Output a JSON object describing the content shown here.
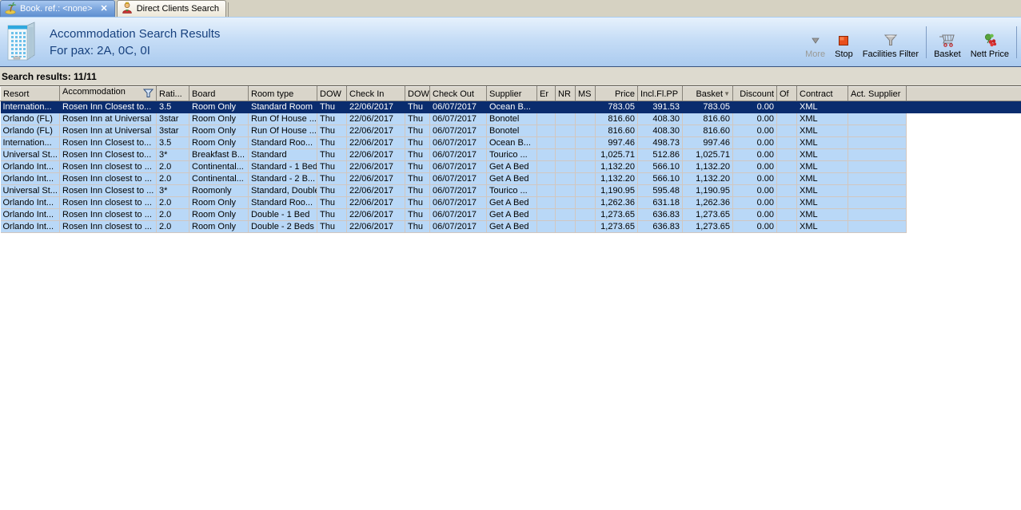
{
  "tabs": [
    {
      "label": "Book. ref.: <none>",
      "close_glyph": "✕",
      "icon": "palm-tree-icon",
      "active": true
    },
    {
      "label": "Direct Clients Search",
      "icon": "person-icon",
      "active": false
    }
  ],
  "header": {
    "title": "Accommodation Search Results",
    "subtitle": "For pax: 2A, 0C, 0I",
    "icon": "building-icon"
  },
  "toolbar": {
    "more": "More",
    "stop": "Stop",
    "facilities_filter": "Facilities Filter",
    "basket": "Basket",
    "nett_price": "Nett Price"
  },
  "results_bar": {
    "label": "Search results: 11/11"
  },
  "colors": {
    "selected_row": "#0A2C6E",
    "row_background": "#B9D8F7",
    "header_text": "#17417E",
    "stop_icon": "#E8501E"
  },
  "table": {
    "selected_index": 0,
    "columns": [
      {
        "label": "Resort"
      },
      {
        "label": "Accommodation",
        "filter_icon": "filter-funnel"
      },
      {
        "label": "Rati..."
      },
      {
        "label": "Board"
      },
      {
        "label": "Room type"
      },
      {
        "label": "DOW"
      },
      {
        "label": "Check In"
      },
      {
        "label": "DOW"
      },
      {
        "label": "Check Out"
      },
      {
        "label": "Supplier"
      },
      {
        "label": "Er"
      },
      {
        "label": "NR"
      },
      {
        "label": "MS"
      },
      {
        "label": "Price"
      },
      {
        "label": "Incl.Fl.PP"
      },
      {
        "label": "Basket",
        "sort_icon": "▼"
      },
      {
        "label": "Discount"
      },
      {
        "label": "Of"
      },
      {
        "label": "Contract"
      },
      {
        "label": "Act. Supplier"
      }
    ],
    "rows": [
      [
        "Internation...",
        "Rosen Inn Closest to...",
        "3.5",
        "Room Only",
        "Standard Room",
        "Thu",
        "22/06/2017",
        "Thu",
        "06/07/2017",
        "Ocean B...",
        "",
        "",
        "",
        "783.05",
        "391.53",
        "783.05",
        "0.00",
        "",
        "XML",
        ""
      ],
      [
        "Orlando (FL)",
        "Rosen Inn at Universal",
        "3star",
        "Room Only",
        "Run Of House ...",
        "Thu",
        "22/06/2017",
        "Thu",
        "06/07/2017",
        "Bonotel",
        "",
        "",
        "",
        "816.60",
        "408.30",
        "816.60",
        "0.00",
        "",
        "XML",
        ""
      ],
      [
        "Orlando (FL)",
        "Rosen Inn at Universal",
        "3star",
        "Room Only",
        "Run Of House ...",
        "Thu",
        "22/06/2017",
        "Thu",
        "06/07/2017",
        "Bonotel",
        "",
        "",
        "",
        "816.60",
        "408.30",
        "816.60",
        "0.00",
        "",
        "XML",
        ""
      ],
      [
        "Internation...",
        "Rosen Inn Closest to...",
        "3.5",
        "Room Only",
        "Standard Roo...",
        "Thu",
        "22/06/2017",
        "Thu",
        "06/07/2017",
        "Ocean B...",
        "",
        "",
        "",
        "997.46",
        "498.73",
        "997.46",
        "0.00",
        "",
        "XML",
        ""
      ],
      [
        "Universal St...",
        "Rosen Inn Closest to...",
        "3*",
        "Breakfast B...",
        "Standard",
        "Thu",
        "22/06/2017",
        "Thu",
        "06/07/2017",
        "Tourico ...",
        "",
        "",
        "",
        "1,025.71",
        "512.86",
        "1,025.71",
        "0.00",
        "",
        "XML",
        ""
      ],
      [
        "Orlando Int...",
        "Rosen Inn closest to ...",
        "2.0",
        "Continental...",
        "Standard - 1 Bed",
        "Thu",
        "22/06/2017",
        "Thu",
        "06/07/2017",
        "Get A Bed",
        "",
        "",
        "",
        "1,132.20",
        "566.10",
        "1,132.20",
        "0.00",
        "",
        "XML",
        ""
      ],
      [
        "Orlando Int...",
        "Rosen Inn closest to ...",
        "2.0",
        "Continental...",
        "Standard - 2 B...",
        "Thu",
        "22/06/2017",
        "Thu",
        "06/07/2017",
        "Get A Bed",
        "",
        "",
        "",
        "1,132.20",
        "566.10",
        "1,132.20",
        "0.00",
        "",
        "XML",
        ""
      ],
      [
        "Universal St...",
        "Rosen Inn Closest to ...",
        "3*",
        "Roomonly",
        "Standard, Double",
        "Thu",
        "22/06/2017",
        "Thu",
        "06/07/2017",
        "Tourico ...",
        "",
        "",
        "",
        "1,190.95",
        "595.48",
        "1,190.95",
        "0.00",
        "",
        "XML",
        ""
      ],
      [
        "Orlando Int...",
        "Rosen Inn closest to ...",
        "2.0",
        "Room Only",
        "Standard Roo...",
        "Thu",
        "22/06/2017",
        "Thu",
        "06/07/2017",
        "Get A Bed",
        "",
        "",
        "",
        "1,262.36",
        "631.18",
        "1,262.36",
        "0.00",
        "",
        "XML",
        ""
      ],
      [
        "Orlando Int...",
        "Rosen Inn closest to ...",
        "2.0",
        "Room Only",
        "Double - 1 Bed",
        "Thu",
        "22/06/2017",
        "Thu",
        "06/07/2017",
        "Get A Bed",
        "",
        "",
        "",
        "1,273.65",
        "636.83",
        "1,273.65",
        "0.00",
        "",
        "XML",
        ""
      ],
      [
        "Orlando Int...",
        "Rosen Inn closest to ...",
        "2.0",
        "Room Only",
        "Double - 2 Beds",
        "Thu",
        "22/06/2017",
        "Thu",
        "06/07/2017",
        "Get A Bed",
        "",
        "",
        "",
        "1,273.65",
        "636.83",
        "1,273.65",
        "0.00",
        "",
        "XML",
        ""
      ]
    ]
  }
}
